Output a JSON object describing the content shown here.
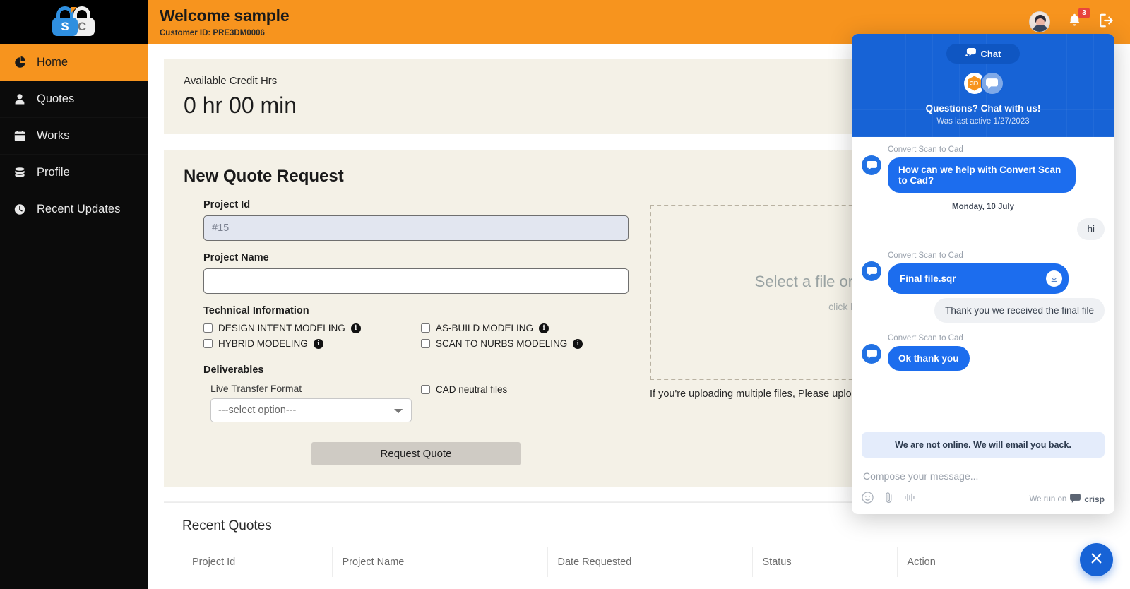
{
  "sidebar": {
    "logo": {
      "left_letter": "S",
      "right_letter": "C"
    },
    "items": [
      {
        "label": "Home",
        "icon": "pie-chart-icon",
        "active": true
      },
      {
        "label": "Quotes",
        "icon": "user-icon",
        "active": false
      },
      {
        "label": "Works",
        "icon": "calendar-icon",
        "active": false
      },
      {
        "label": "Profile",
        "icon": "database-icon",
        "active": false
      },
      {
        "label": "Recent Updates",
        "icon": "clock-icon",
        "active": false
      }
    ]
  },
  "topbar": {
    "welcome": "Welcome sample",
    "customer_id": "Customer ID: PRE3DM0006",
    "notification_count": "3",
    "accent_color": "#F7941E"
  },
  "credit": {
    "label": "Available Credit Hrs",
    "value": "0 hr 00 min"
  },
  "quote": {
    "title": "New Quote Request",
    "project_id_label": "Project Id",
    "project_id_value": "#15",
    "project_name_label": "Project Name",
    "project_name_value": "",
    "technical_info_label": "Technical Information",
    "checkboxes": [
      {
        "label": "DESIGN INTENT MODELING",
        "checked": false
      },
      {
        "label": "AS-BUILD MODELING",
        "checked": false
      },
      {
        "label": "HYBRID MODELING",
        "checked": false
      },
      {
        "label": "SCAN TO NURBS MODELING",
        "checked": false
      }
    ],
    "deliverables_label": "Deliverables",
    "live_transfer_label": "Live Transfer Format",
    "select_value": "---select option---",
    "cad_neutral_label": "CAD neutral files",
    "submit_label": "Request Quote",
    "dropzone_main": "Select a file or drag and drop here",
    "dropzone_sub": "click here to browse",
    "dropzone_note": "If you're uploading multiple files, Please upload a zip file"
  },
  "recent_quotes": {
    "title": "Recent Quotes",
    "columns": [
      "Project Id",
      "Project Name",
      "Date Requested",
      "Status",
      "Action"
    ]
  },
  "chat": {
    "pill_label": "Chat",
    "title": "Questions? Chat with us!",
    "subtitle": "Was last active 1/27/2023",
    "day_separator": "Monday, 10 July",
    "agent_name": "Convert Scan to Cad",
    "messages": [
      {
        "side": "in",
        "name": "Convert Scan to Cad",
        "text": "How can we help with Convert Scan to Cad?",
        "kind": "text"
      },
      {
        "side": "out",
        "text": "hi",
        "kind": "text"
      },
      {
        "side": "in",
        "name": "Convert Scan to Cad",
        "text": "Final file.sqr",
        "kind": "file"
      },
      {
        "side": "out",
        "text": "Thank you we received the final file",
        "kind": "text"
      },
      {
        "side": "in",
        "name": "Convert Scan to Cad",
        "text": "Ok thank you",
        "kind": "text"
      }
    ],
    "offline_notice": "We are not online. We will email you back.",
    "compose_placeholder": "Compose your message...",
    "run_on_prefix": "We run on",
    "run_on_brand": "crisp",
    "brand_color": "#1763D6"
  }
}
